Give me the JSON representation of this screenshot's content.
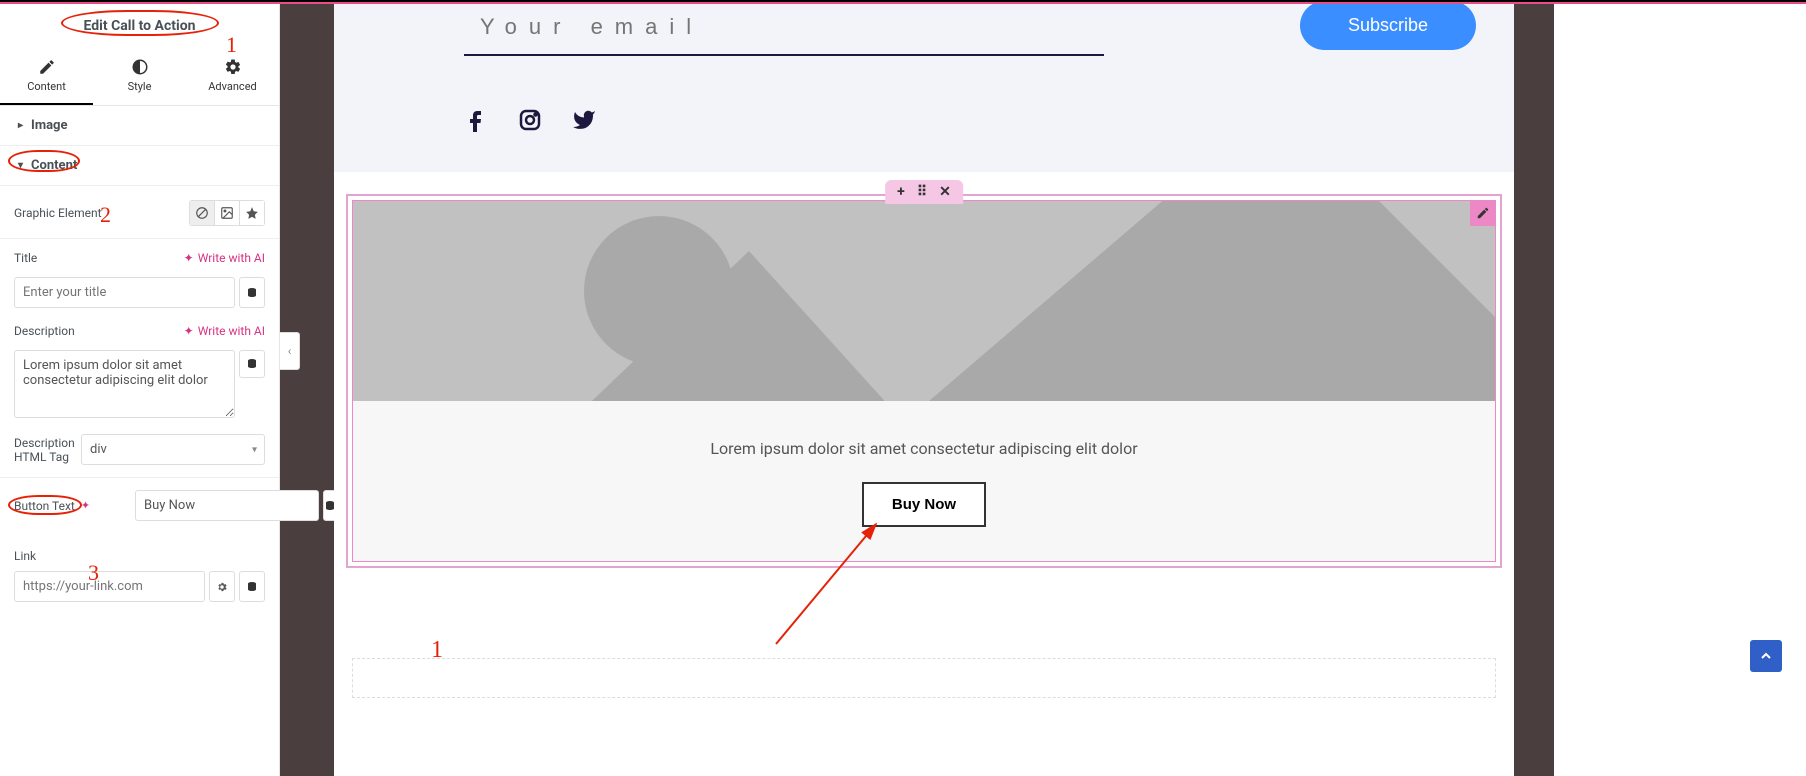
{
  "colors": {
    "accent_pink": "#ec88c6",
    "accent_red_annot": "#e52207",
    "subscribe_blue": "#3a8eff"
  },
  "sidebar": {
    "title": "Edit Call to Action",
    "tabs": {
      "content": "Content",
      "style": "Style",
      "advanced": "Advanced"
    },
    "sections": {
      "image": "Image",
      "content": "Content"
    },
    "fields": {
      "graphic_element": "Graphic Element",
      "title_label": "Title",
      "write_ai": "Write with AI",
      "title_placeholder": "Enter your title",
      "description_label": "Description",
      "description_value": "Lorem ipsum dolor sit amet consectetur adipiscing elit dolor",
      "desc_html_tag_label": "Description HTML Tag",
      "desc_html_tag_value": "div",
      "button_text_label": "Button Text",
      "button_text_value": "Buy Now",
      "link_label": "Link",
      "link_placeholder": "https://your-link.com"
    }
  },
  "annotations": {
    "one": "1",
    "two": "2",
    "three": "3",
    "canvas_one": "1"
  },
  "canvas": {
    "email_placeholder": "Your email",
    "subscribe": "Subscribe",
    "widget_description": "Lorem ipsum dolor sit amet consectetur adipiscing elit dolor",
    "buy_now": "Buy Now"
  },
  "icons": {
    "plus": "+",
    "drag": "⠿",
    "close": "✕"
  }
}
